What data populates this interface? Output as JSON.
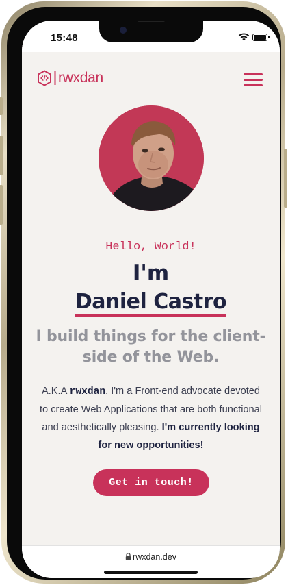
{
  "status_bar": {
    "time": "15:48",
    "icons": [
      "wifi-icon",
      "battery-icon"
    ]
  },
  "header": {
    "logo_icon": "code-hexagon-icon",
    "logo_text": "rwxdan",
    "menu_icon": "hamburger-menu-icon"
  },
  "hero": {
    "avatar_alt": "Profile photo",
    "greeting": "Hello, World!",
    "intro": "I'm",
    "name": "Daniel Castro",
    "tagline": "I build things for the client-side of the Web.",
    "bio": {
      "prefix": "A.K.A ",
      "handle": "rwxdan",
      "middle": ". I'm a Front-end advocate devoted to create Web Applications that are both functional and aesthetically pleasing. ",
      "highlight": "I'm currently looking for new opportunities!"
    },
    "cta_label": "Get in touch!"
  },
  "browser": {
    "lock_icon": "lock-icon",
    "url": "rwxdan.dev"
  },
  "colors": {
    "accent": "#c8325a",
    "heading": "#1e2340",
    "muted": "#93949b",
    "background": "#f4f2ef"
  }
}
